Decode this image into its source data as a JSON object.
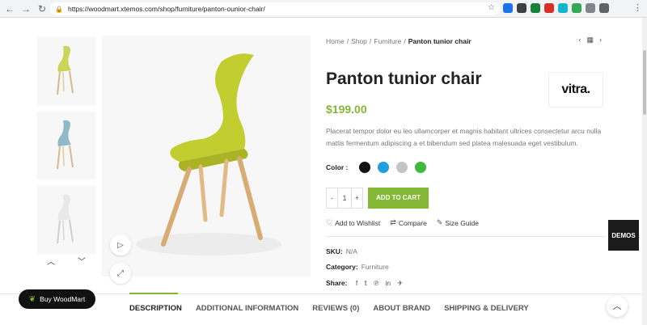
{
  "browser": {
    "url": "https://woodmart.xtemos.com/shop/furniture/panton-ounior-chair/",
    "back_icon": "back-arrow-icon",
    "forward_icon": "forward-arrow-icon",
    "reload_icon": "reload-icon"
  },
  "breadcrumb": {
    "home": "Home",
    "shop": "Shop",
    "category": "Furniture",
    "current": "Panton tunior chair",
    "separator": "/"
  },
  "product": {
    "title": "Panton tunior chair",
    "brand_logo_text": "vitra.",
    "price": "$199.00",
    "description": "Placerat tempor dolor eu leo ullamcorper et magnis habitant ultrices consectetur arcu nulla mattis fermentum adipiscing a et bibendum sed platea malesuada eget vestibulum.",
    "color_label": "Color :",
    "colors": [
      "#111111",
      "#1e9fe0",
      "#c4c4c4",
      "#3fba3f"
    ],
    "quantity": "1",
    "qty_minus": "-",
    "qty_plus": "+",
    "add_to_cart": "ADD TO CART",
    "accent": "#83b735"
  },
  "actions": {
    "wishlist": "Add to Wishlist",
    "compare": "Compare",
    "size_guide": "Size Guide"
  },
  "meta": {
    "sku_label": "SKU:",
    "sku_value": "N/A",
    "category_label": "Category:",
    "category_value": "Furniture",
    "share_label": "Share:",
    "share_icons": [
      "f",
      "𝕥",
      "℗",
      "in",
      "✈"
    ]
  },
  "tabs": [
    "DESCRIPTION",
    "ADDITIONAL INFORMATION",
    "REVIEWS (0)",
    "ABOUT BRAND",
    "SHIPPING & DELIVERY"
  ],
  "floating": {
    "buy_label": "Buy WoodMart",
    "demos_label": "DEMOS"
  }
}
